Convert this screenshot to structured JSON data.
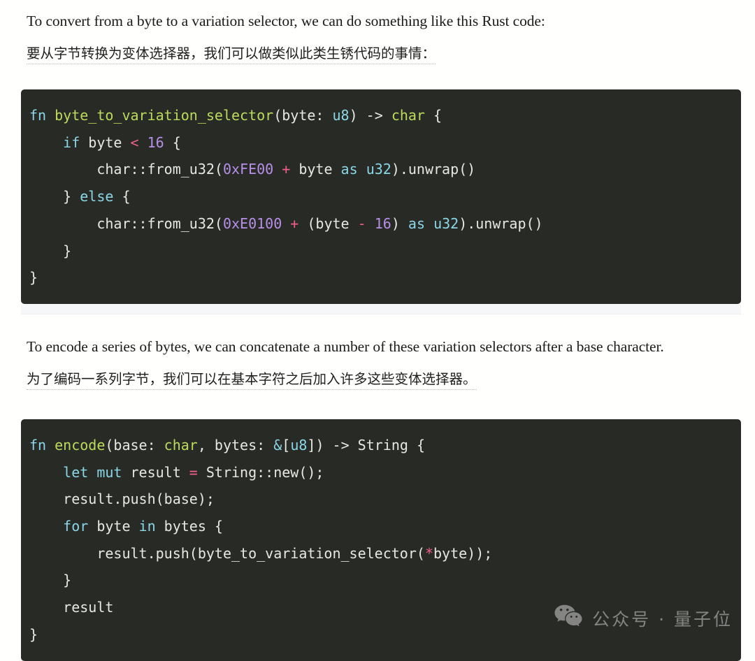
{
  "page": {
    "background_color": "#fffffd",
    "code_background_color": "#282a26",
    "code_text_color": "#e8e8e3",
    "accent_keyword_color": "#8ad7e8",
    "accent_function_color": "#bddb5b",
    "accent_number_color": "#b78fe8",
    "accent_operator_color": "#ef5f8c"
  },
  "paragraph_1": {
    "english": "To convert from a byte to a variation selector, we can do something like this Rust code:",
    "chinese": "要从字节转换为变体选择器，我们可以做类似此类生锈代码的事情："
  },
  "code_block_1": {
    "language": "rust",
    "lines": [
      [
        {
          "t": "fn ",
          "c": "kw"
        },
        {
          "t": "byte_to_variation_selector",
          "c": "fnname"
        },
        {
          "t": "(byte: ",
          "c": "plain"
        },
        {
          "t": "u8",
          "c": "type"
        },
        {
          "t": ") -> ",
          "c": "plain"
        },
        {
          "t": "char",
          "c": "typeg"
        },
        {
          "t": " {",
          "c": "plain"
        }
      ],
      [
        {
          "t": "    ",
          "c": "plain"
        },
        {
          "t": "if",
          "c": "kw"
        },
        {
          "t": " byte ",
          "c": "plain"
        },
        {
          "t": "<",
          "c": "op"
        },
        {
          "t": " ",
          "c": "plain"
        },
        {
          "t": "16",
          "c": "num"
        },
        {
          "t": " {",
          "c": "plain"
        }
      ],
      [
        {
          "t": "        char::from_u32(",
          "c": "plain"
        },
        {
          "t": "0xFE00",
          "c": "num"
        },
        {
          "t": " ",
          "c": "plain"
        },
        {
          "t": "+",
          "c": "op"
        },
        {
          "t": " byte ",
          "c": "plain"
        },
        {
          "t": "as",
          "c": "kw"
        },
        {
          "t": " ",
          "c": "plain"
        },
        {
          "t": "u32",
          "c": "type"
        },
        {
          "t": ").unwrap()",
          "c": "plain"
        }
      ],
      [
        {
          "t": "    } ",
          "c": "plain"
        },
        {
          "t": "else",
          "c": "kw"
        },
        {
          "t": " {",
          "c": "plain"
        }
      ],
      [
        {
          "t": "        char::from_u32(",
          "c": "plain"
        },
        {
          "t": "0xE0100",
          "c": "num"
        },
        {
          "t": " ",
          "c": "plain"
        },
        {
          "t": "+",
          "c": "op"
        },
        {
          "t": " (byte ",
          "c": "plain"
        },
        {
          "t": "-",
          "c": "op"
        },
        {
          "t": " ",
          "c": "plain"
        },
        {
          "t": "16",
          "c": "num"
        },
        {
          "t": ") ",
          "c": "plain"
        },
        {
          "t": "as",
          "c": "kw"
        },
        {
          "t": " ",
          "c": "plain"
        },
        {
          "t": "u32",
          "c": "type"
        },
        {
          "t": ").unwrap()",
          "c": "plain"
        }
      ],
      [
        {
          "t": "    }",
          "c": "plain"
        }
      ],
      [
        {
          "t": "}",
          "c": "plain"
        }
      ]
    ],
    "has_horizontal_scrollbar": true
  },
  "paragraph_2": {
    "english": "To encode a series of bytes, we can concatenate a number of these variation selectors after a base character.",
    "chinese": "为了编码一系列字节，我们可以在基本字符之后加入许多这些变体选择器。"
  },
  "code_block_2": {
    "language": "rust",
    "lines": [
      [
        {
          "t": "fn ",
          "c": "kw"
        },
        {
          "t": "encode",
          "c": "fnname"
        },
        {
          "t": "(base: ",
          "c": "plain"
        },
        {
          "t": "char",
          "c": "typeg"
        },
        {
          "t": ", bytes: ",
          "c": "plain"
        },
        {
          "t": "&",
          "c": "type"
        },
        {
          "t": "[",
          "c": "plain"
        },
        {
          "t": "u8",
          "c": "type"
        },
        {
          "t": "]) -> String {",
          "c": "plain"
        }
      ],
      [
        {
          "t": "    ",
          "c": "plain"
        },
        {
          "t": "let",
          "c": "kw"
        },
        {
          "t": " ",
          "c": "plain"
        },
        {
          "t": "mut",
          "c": "kw"
        },
        {
          "t": " result ",
          "c": "plain"
        },
        {
          "t": "=",
          "c": "op"
        },
        {
          "t": " String::new();",
          "c": "plain"
        }
      ],
      [
        {
          "t": "    result.push(base);",
          "c": "plain"
        }
      ],
      [
        {
          "t": "    ",
          "c": "plain"
        },
        {
          "t": "for",
          "c": "kw"
        },
        {
          "t": " byte ",
          "c": "plain"
        },
        {
          "t": "in",
          "c": "kw"
        },
        {
          "t": " bytes {",
          "c": "plain"
        }
      ],
      [
        {
          "t": "        result.push(byte_to_variation_selector(",
          "c": "plain"
        },
        {
          "t": "*",
          "c": "op"
        },
        {
          "t": "byte));",
          "c": "plain"
        }
      ],
      [
        {
          "t": "    }",
          "c": "plain"
        }
      ],
      [
        {
          "t": "    result",
          "c": "plain"
        }
      ],
      [
        {
          "t": "}",
          "c": "plain"
        }
      ]
    ],
    "has_horizontal_scrollbar": false
  },
  "watermark": {
    "icon": "wechat-icon",
    "text": "公众号 · 量子位",
    "color": "#bdbdbd"
  }
}
